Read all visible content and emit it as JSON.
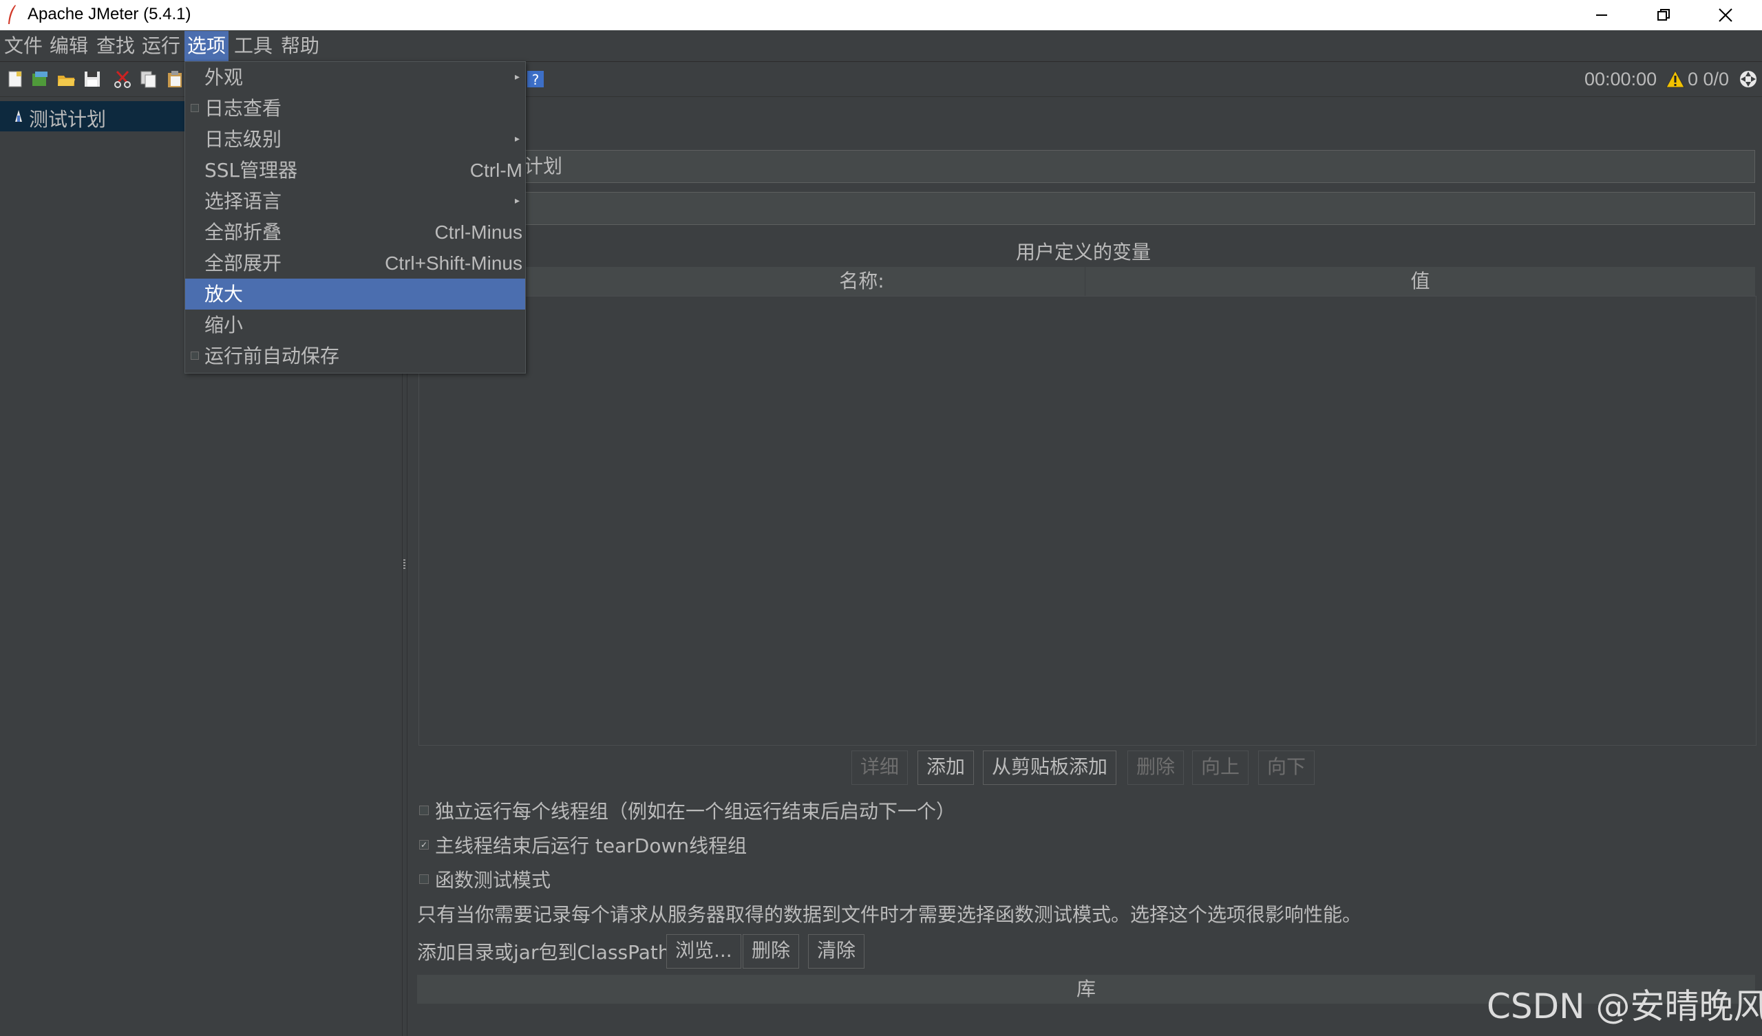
{
  "window": {
    "title": "Apache JMeter (5.4.1)"
  },
  "menubar": {
    "items": [
      "文件",
      "编辑",
      "查找",
      "运行",
      "选项",
      "工具",
      "帮助"
    ],
    "active": "选项"
  },
  "toolbar": {
    "timer": "00:00:00",
    "counts": "0 0/0",
    "icons": [
      "new-icon",
      "templates-icon",
      "open-icon",
      "save-icon",
      "cut-icon",
      "copy-icon",
      "paste-icon",
      "help-icon",
      "warning-icon",
      "remote-icon"
    ]
  },
  "tree": {
    "root_label": "测试计划"
  },
  "dropdown": {
    "items": [
      {
        "label": "外观",
        "shortcut": "",
        "submenu": true,
        "checkbox": false
      },
      {
        "label": "日志查看",
        "shortcut": "",
        "submenu": false,
        "checkbox": true
      },
      {
        "label": "日志级别",
        "shortcut": "",
        "submenu": true,
        "checkbox": false
      },
      {
        "label": "SSL管理器",
        "shortcut": "Ctrl-M",
        "submenu": false,
        "checkbox": false
      },
      {
        "label": "选择语言",
        "shortcut": "",
        "submenu": true,
        "checkbox": false
      },
      {
        "label": "全部折叠",
        "shortcut": "Ctrl-Minus",
        "submenu": false,
        "checkbox": false
      },
      {
        "label": "全部展开",
        "shortcut": "Ctrl+Shift-Minus",
        "submenu": false,
        "checkbox": false
      },
      {
        "label": "放大",
        "shortcut": "",
        "submenu": false,
        "checkbox": false
      },
      {
        "label": "缩小",
        "shortcut": "",
        "submenu": false,
        "checkbox": false
      },
      {
        "label": "运行前自动保存",
        "shortcut": "",
        "submenu": false,
        "checkbox": true
      }
    ],
    "selected": "放大"
  },
  "plan": {
    "name_value": "计划",
    "comment_value": "",
    "vars_title": "用户定义的变量",
    "col_name": "名称:",
    "col_value": "值",
    "buttons": {
      "detail": "详细",
      "add": "添加",
      "add_clipboard": "从剪贴板添加",
      "delete": "删除",
      "up": "向上",
      "down": "向下"
    },
    "option_serial": "独立运行每个线程组（例如在一个组运行结束后启动下一个）",
    "option_teardown": "主线程结束后运行 tearDown线程组",
    "option_functional": "函数测试模式",
    "functional_note": "只有当你需要记录每个请求从服务器取得的数据到文件时才需要选择函数测试模式。选择这个选项很影响性能。",
    "classpath_label": "添加目录或jar包到ClassPath",
    "classpath_buttons": {
      "browse": "浏览...",
      "delete": "删除",
      "clear": "清除"
    },
    "library_header": "库"
  },
  "watermark": "CSDN @安晴晚风"
}
